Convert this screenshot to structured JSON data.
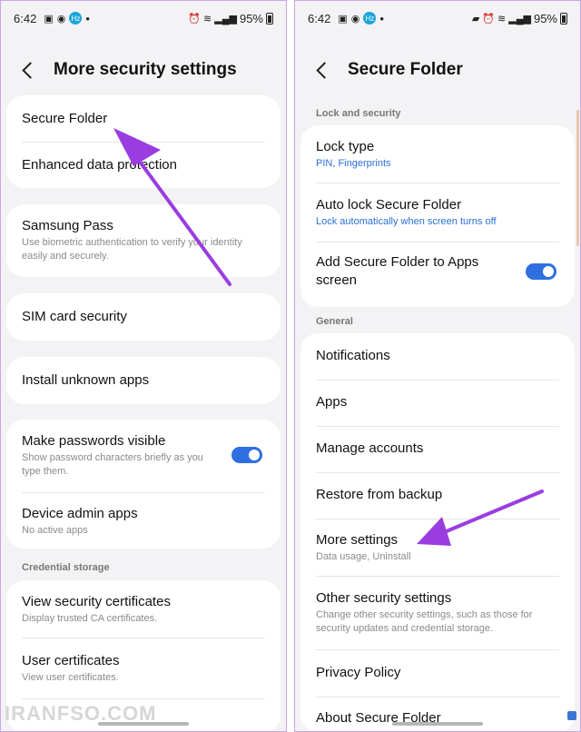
{
  "left": {
    "status": {
      "time": "6:42",
      "battery": "95%"
    },
    "title": "More security settings",
    "items": {
      "secure_folder": "Secure Folder",
      "enhanced": "Enhanced data protection",
      "samsung_pass": "Samsung Pass",
      "samsung_pass_sub": "Use biometric authentication to verify your identity easily and securely.",
      "sim": "SIM card security",
      "install": "Install unknown apps",
      "passwords": "Make passwords visible",
      "passwords_sub": "Show password characters briefly as you type them.",
      "device_admin": "Device admin apps",
      "device_admin_sub": "No active apps",
      "credential_section": "Credential storage",
      "view_certs": "View security certificates",
      "view_certs_sub": "Display trusted CA certificates.",
      "user_certs": "User certificates",
      "user_certs_sub": "View user certificates."
    },
    "toggles": {
      "passwords_visible": true
    }
  },
  "right": {
    "status": {
      "time": "6:42",
      "battery": "95%"
    },
    "title": "Secure Folder",
    "sections": {
      "lock": "Lock and security",
      "general": "General"
    },
    "items": {
      "lock_type": "Lock type",
      "lock_type_sub": "PIN, Fingerprints",
      "auto_lock": "Auto lock Secure Folder",
      "auto_lock_sub": "Lock automatically when screen turns off",
      "add_to_apps": "Add Secure Folder to Apps screen",
      "notifications": "Notifications",
      "apps": "Apps",
      "manage_accounts": "Manage accounts",
      "restore": "Restore from backup",
      "more_settings": "More settings",
      "more_settings_sub": "Data usage, Uninstall",
      "other_security": "Other security settings",
      "other_security_sub": "Change other security settings, such as those for security updates and credential storage.",
      "privacy": "Privacy Policy",
      "about": "About Secure Folder"
    },
    "toggles": {
      "add_to_apps": true
    }
  },
  "watermark": "IRANFSO.COM",
  "colors": {
    "accent": "#2f6fe0",
    "arrow": "#9a3de0",
    "link": "#2a6fd6"
  }
}
